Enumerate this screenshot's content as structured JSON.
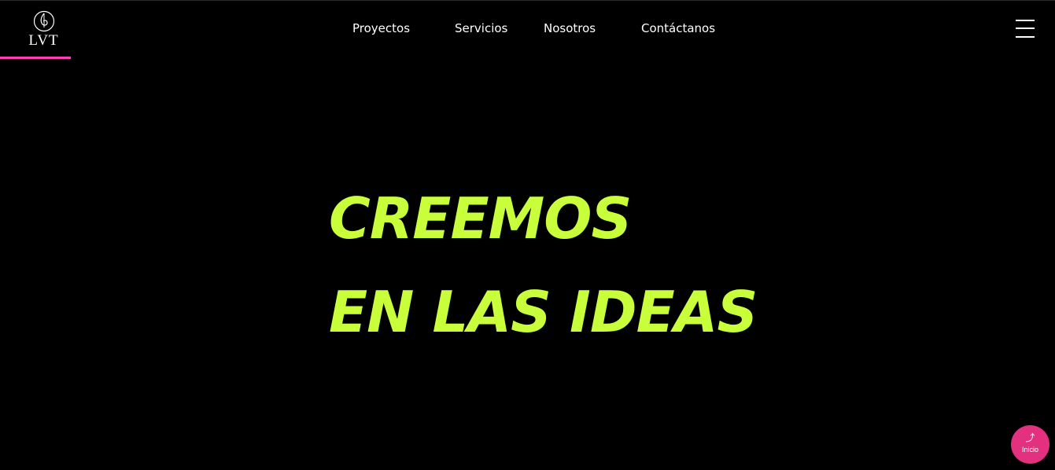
{
  "header": {
    "logo": {
      "text": "LVT",
      "icon": "leaf-circle-icon",
      "underline_color": "#ff3fb4"
    },
    "nav": [
      {
        "label": "Proyectos"
      },
      {
        "label": "Servicios"
      },
      {
        "label": "Nosotros"
      },
      {
        "label": "Contáctanos"
      }
    ],
    "menu_icon": "hamburger-icon"
  },
  "hero": {
    "line1": "CREEMOS",
    "line2": "EN LAS IDEAS",
    "color": "#c8ff3a"
  },
  "floating_button": {
    "icon": "arrow-up-icon",
    "icon_glyph": "⤴",
    "label": "Inicio",
    "color": "#e3307f"
  },
  "theme": {
    "background": "#000000",
    "text": "#ffffff"
  }
}
